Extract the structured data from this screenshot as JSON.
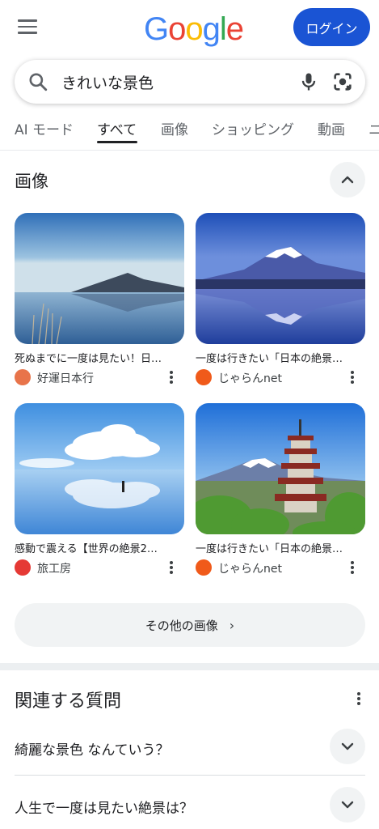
{
  "header": {
    "logo_letters": [
      "G",
      "o",
      "o",
      "g",
      "l",
      "e"
    ],
    "logo_colors": [
      "#4285f4",
      "#ea4335",
      "#fbbc05",
      "#4285f4",
      "#34a853",
      "#ea4335"
    ],
    "login_label": "ログイン"
  },
  "search": {
    "query": "きれいな景色"
  },
  "tabs": [
    {
      "label": "AI モード",
      "active": false
    },
    {
      "label": "すべて",
      "active": true
    },
    {
      "label": "画像",
      "active": false
    },
    {
      "label": "ショッピング",
      "active": false
    },
    {
      "label": "動画",
      "active": false
    },
    {
      "label": "ニ",
      "active": false
    }
  ],
  "images_section": {
    "title": "画像",
    "items": [
      {
        "caption": "死ぬまでに一度は見たい！日…",
        "source": "好運日本行",
        "source_color": "#e8744a"
      },
      {
        "caption": "一度は行きたい「日本の絶景…",
        "source": "じゃらんnet",
        "source_color": "#f05a1a"
      },
      {
        "caption": "感動で震える【世界の絶景2…",
        "source": "旅工房",
        "source_color": "#e53935"
      },
      {
        "caption": "一度は行きたい「日本の絶景…",
        "source": "じゃらんnet",
        "source_color": "#f05a1a"
      }
    ],
    "more_label": "その他の画像"
  },
  "related_questions": {
    "title": "関連する質問",
    "questions": [
      "綺麗な景色 なんていう？",
      "人生で一度は見たい絶景は？"
    ]
  },
  "colors": {
    "accent": "#1a54d4",
    "chip_bg": "#f1f3f4"
  }
}
